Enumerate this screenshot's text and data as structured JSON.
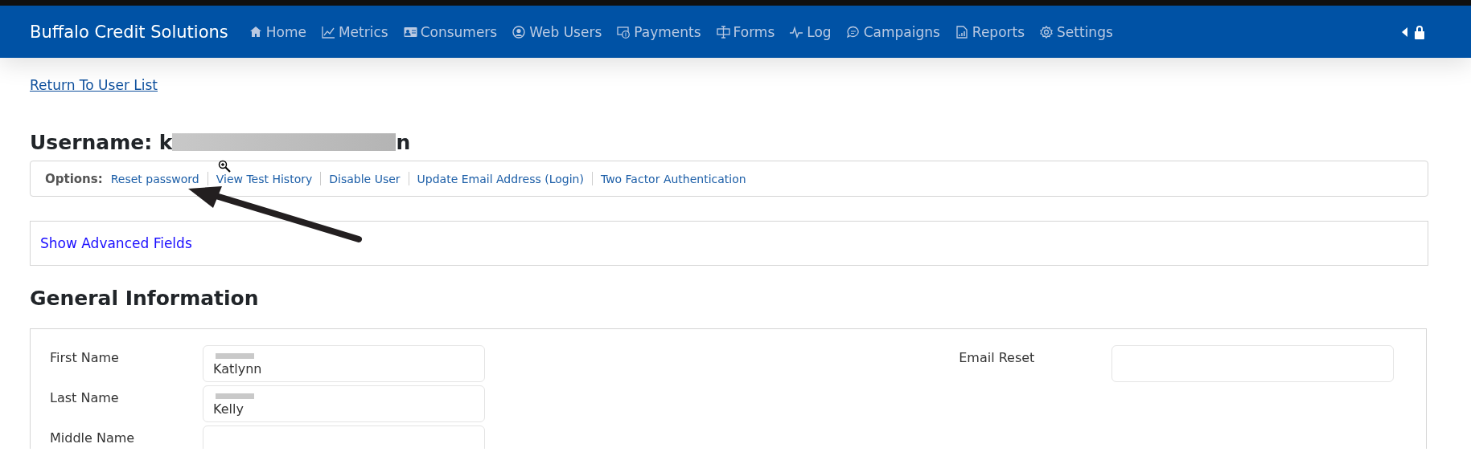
{
  "navbar": {
    "brand": "Buffalo Credit Solutions",
    "items": [
      {
        "label": "Home",
        "kind": "home"
      },
      {
        "label": "Metrics",
        "kind": "chart"
      },
      {
        "label": "Consumers",
        "kind": "card"
      },
      {
        "label": "Web Users",
        "kind": "user"
      },
      {
        "label": "Payments",
        "kind": "money"
      },
      {
        "label": "Forms",
        "kind": "forms"
      },
      {
        "label": "Log",
        "kind": "pulse"
      },
      {
        "label": "Campaigns",
        "kind": "chat"
      },
      {
        "label": "Reports",
        "kind": "report"
      },
      {
        "label": "Settings",
        "kind": "gear"
      }
    ]
  },
  "return_link": "Return To User List",
  "username": {
    "start": "Username: k",
    "end": "n",
    "redacted": true
  },
  "options": {
    "label": "Options:",
    "links": [
      "Reset password",
      "View Test History",
      "Disable User",
      "Update Email Address (Login)",
      "Two Factor Authentication"
    ]
  },
  "advanced_toggle": "Show Advanced Fields",
  "general_information": {
    "title": "General Information",
    "left_fields": [
      {
        "label": "First Name",
        "value": "Katlynn",
        "redacted": true
      },
      {
        "label": "Last Name",
        "value": "Kelly",
        "redacted": true
      },
      {
        "label": "Middle Name"
      }
    ],
    "right_fields": [
      {
        "label": "Email Reset"
      }
    ]
  }
}
